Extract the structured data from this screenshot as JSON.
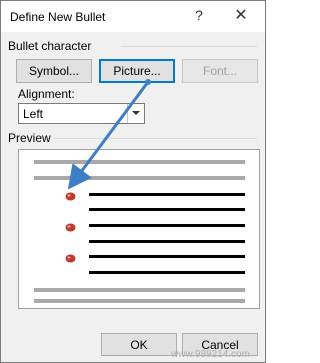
{
  "window": {
    "title": "Define New Bullet",
    "help_glyph": "?",
    "close_glyph": "✕"
  },
  "bullet_character": {
    "label": "Bullet character",
    "symbol_button": "Symbol...",
    "picture_button": "Picture...",
    "font_button": "Font..."
  },
  "alignment": {
    "label": "Alignment:",
    "value": "Left"
  },
  "preview": {
    "label": "Preview",
    "bullet_color": "#c0392b"
  },
  "footer": {
    "ok_button": "OK",
    "cancel_button": "Cancel"
  },
  "annotation": {
    "arrow_color": "#3d7ec5"
  },
  "watermark": "www.989214.com"
}
